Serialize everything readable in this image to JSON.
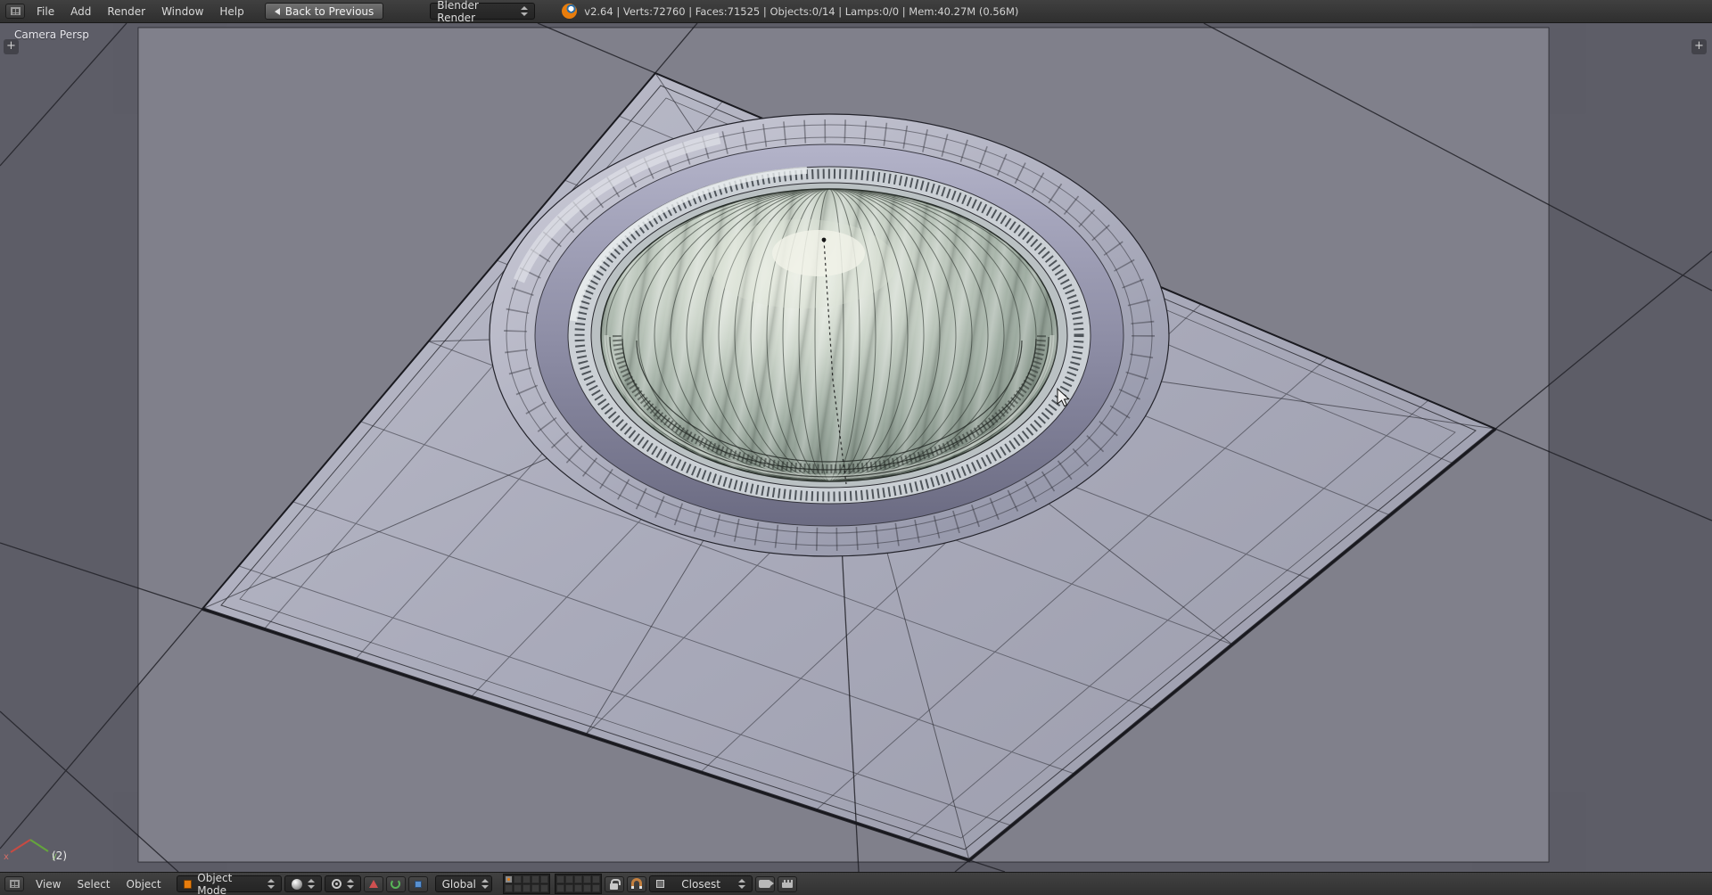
{
  "topbar": {
    "menus": [
      "File",
      "Add",
      "Render",
      "Window",
      "Help"
    ],
    "back_button": "Back to Previous",
    "engine": "Blender Render",
    "stats": "v2.64 | Verts:72760 | Faces:71525 | Objects:0/14 | Lamps:0/0 | Mem:40.27M (0.56M)"
  },
  "viewport": {
    "view_label": "Camera Persp",
    "layer_indicator": "(2)",
    "axis_x": "x",
    "axis_y": "y",
    "open_left_region_glyph": "+",
    "open_right_region_glyph": "+"
  },
  "footer": {
    "menus": [
      "View",
      "Select",
      "Object"
    ],
    "mode": "Object Mode",
    "orientation": "Global",
    "snap_target": "Closest"
  },
  "icons": {
    "info_editor": "grid-glyph",
    "viewport_editor": "grid-glyph",
    "back_arrow": "left-triangle",
    "blender_logo": "orange-disc",
    "dropdown_chevron": "up-down-triangles",
    "object_mode": "orange-cube",
    "viewport_shading": "sphere",
    "pivot_point": "circle-dot",
    "manipulator_translate": "red-triangle",
    "manipulator_rotate": "green-arc",
    "manipulator_scale": "blue-square",
    "layers_widget": "cell-grid",
    "lock_to_scene": "padlock",
    "snap_magnet": "magnet",
    "snap_element": "square",
    "opengl_render_still": "camera",
    "opengl_render_anim": "clapperboard"
  },
  "colors": {
    "accent": "#e87d0d",
    "header_bg": "#383838",
    "viewport_inside": "#80808b",
    "viewport_outside": "#5f5f67",
    "plate": "#a9aaba",
    "glass": "#9fada2",
    "wire": "#23232a",
    "axis_x": "#c84a42",
    "axis_y": "#64a53c"
  }
}
